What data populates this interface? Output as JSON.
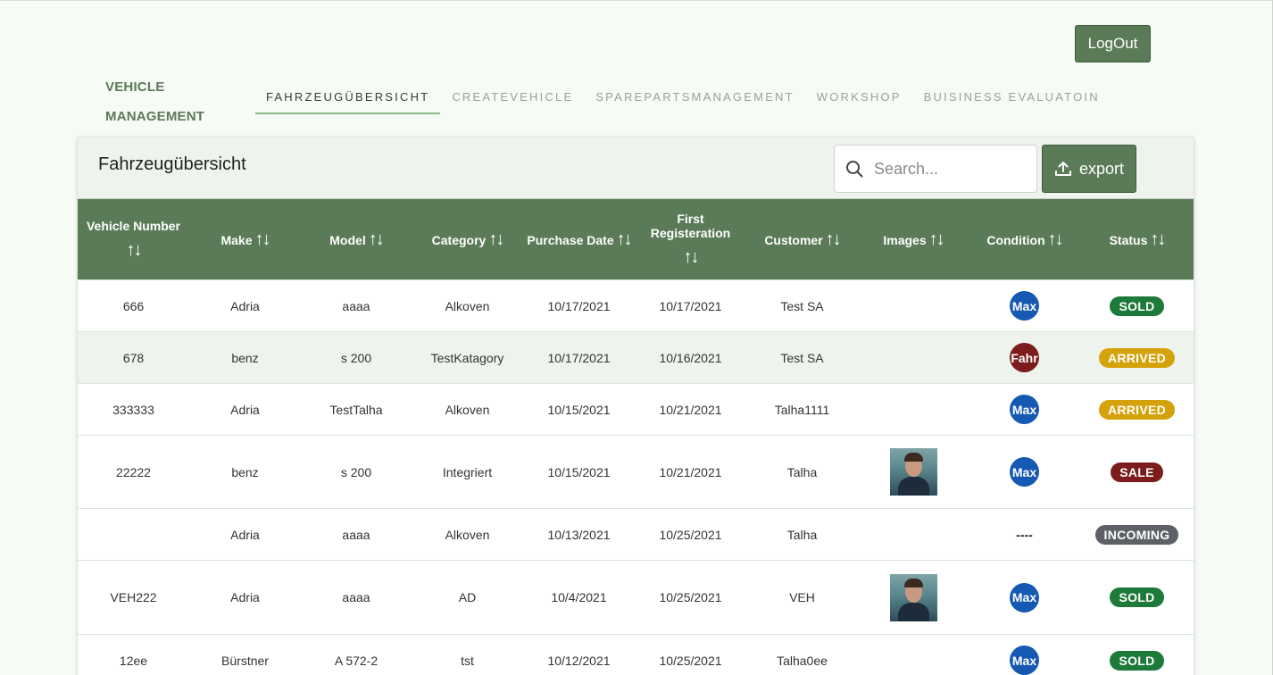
{
  "header": {
    "logout_label": "LogOut",
    "brand_line1": "VEHICLE",
    "brand_line2": "MANAGEMENT"
  },
  "nav": {
    "tabs": [
      {
        "label": "FAHRZEUGÜBERSICHT",
        "active": true
      },
      {
        "label": "CREATEVEHICLE",
        "active": false
      },
      {
        "label": "SPAREPARTSMANAGEMENT",
        "active": false
      },
      {
        "label": "WORKSHOP",
        "active": false
      },
      {
        "label": "BUISINESS EVALUATOIN",
        "active": false
      }
    ]
  },
  "card": {
    "title": "Fahrzeugübersicht",
    "search_placeholder": "Search...",
    "export_label": "export"
  },
  "table": {
    "columns": [
      "Vehicle Number",
      "Make",
      "Model",
      "Category",
      "Purchase Date",
      "First Registeration",
      "Customer",
      "Images",
      "Condition",
      "Status"
    ],
    "sort_glyph": "↑↓",
    "rows": [
      {
        "vehicle_number": "666",
        "make": "Adria",
        "model": "aaaa",
        "category": "Alkoven",
        "purchase_date": "10/17/2021",
        "first_registration": "10/17/2021",
        "customer": "Test SA",
        "image": false,
        "condition": "Max",
        "status": "SOLD"
      },
      {
        "vehicle_number": "678",
        "make": "benz",
        "model": "s 200",
        "category": "TestKatagory",
        "purchase_date": "10/17/2021",
        "first_registration": "10/16/2021",
        "customer": "Test SA",
        "image": false,
        "condition": "Fahr",
        "status": "ARRIVED"
      },
      {
        "vehicle_number": "333333",
        "make": "Adria",
        "model": "TestTalha",
        "category": "Alkoven",
        "purchase_date": "10/15/2021",
        "first_registration": "10/21/2021",
        "customer": "Talha1111",
        "image": false,
        "condition": "Max",
        "status": "ARRIVED"
      },
      {
        "vehicle_number": "22222",
        "make": "benz",
        "model": "s 200",
        "category": "Integriert",
        "purchase_date": "10/15/2021",
        "first_registration": "10/21/2021",
        "customer": "Talha",
        "image": true,
        "condition": "Max",
        "status": "SALE"
      },
      {
        "vehicle_number": "",
        "make": "Adria",
        "model": "aaaa",
        "category": "Alkoven",
        "purchase_date": "10/13/2021",
        "first_registration": "10/25/2021",
        "customer": "Talha",
        "image": false,
        "condition": "----",
        "status": "INCOMING"
      },
      {
        "vehicle_number": "VEH222",
        "make": "Adria",
        "model": "aaaa",
        "category": "AD",
        "purchase_date": "10/4/2021",
        "first_registration": "10/25/2021",
        "customer": "VEH",
        "image": true,
        "condition": "Max",
        "status": "SOLD"
      },
      {
        "vehicle_number": "12ee",
        "make": "Bürstner",
        "model": "A 572-2",
        "category": "tst",
        "purchase_date": "10/12/2021",
        "first_registration": "10/25/2021",
        "customer": "Talha0ee",
        "image": false,
        "condition": "Max",
        "status": "SOLD"
      }
    ]
  },
  "colors": {
    "primary": "#5b7a57",
    "condition_max": "#1559b3",
    "condition_fahr": "#7c1c1c",
    "status_SOLD": "#1e7a3a",
    "status_ARRIVED": "#d4a20a",
    "status_SALE": "#7c1c1c",
    "status_INCOMING": "#5d6166"
  }
}
